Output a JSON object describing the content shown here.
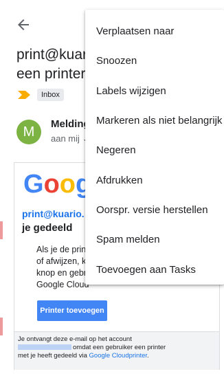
{
  "email": {
    "subject_line1": "print@kuar",
    "subject_line2": "een printer",
    "label": "Inbox",
    "avatar_letter": "M",
    "sender": "Melding",
    "recipient": "aan mij"
  },
  "card": {
    "logo_letters": [
      "G",
      "o",
      "o",
      "g"
    ],
    "link_text": "print@kuario.",
    "heading": "je gedeeld",
    "body_lines": [
      "Als je de prin",
      "of afwijzen, k",
      "knop en gebr",
      "Google Cloud"
    ],
    "button_label": "Printer toevoegen",
    "footer_line1": "Je ontvangt deze e-mail op het account",
    "footer_line2_text": "omdat een gebruiker een printer",
    "footer_line3_text": "met je heeft gedeeld via ",
    "footer_link": "Google Cloudprinter",
    "footer_end": "."
  },
  "menu": {
    "items": [
      "Verplaatsen naar",
      "Snoozen",
      "Labels wijzigen",
      "Markeren als niet belangrijk",
      "Negeren",
      "Afdrukken",
      "Oorspr. versie herstellen",
      "Spam melden",
      "Toevoegen aan Tasks"
    ]
  },
  "colors": {
    "accent": "#1a73e8",
    "button": "#4285f4",
    "avatar": "#7cb342",
    "importance": "#f9ab00"
  }
}
